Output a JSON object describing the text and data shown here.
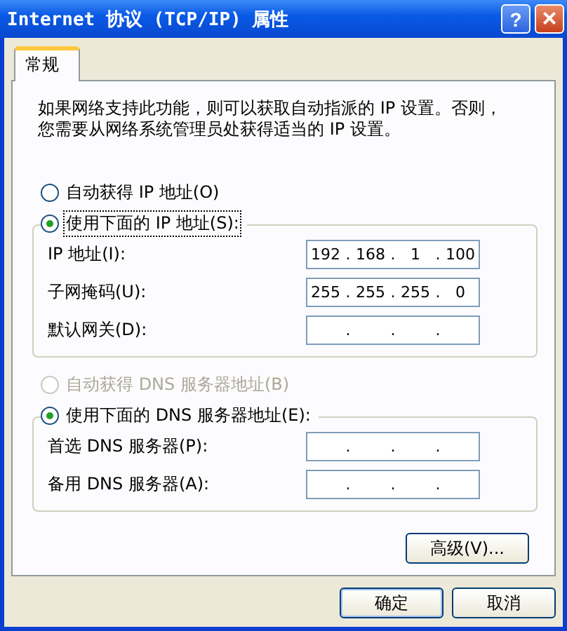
{
  "window": {
    "title": "Internet 协议 (TCP/IP) 属性",
    "help_button": "?",
    "close_button": "×"
  },
  "tabs": [
    {
      "label": "常规",
      "selected": true
    }
  ],
  "intro": "如果网络支持此功能，则可以获取自动指派的 IP 设置。否则，您需要从网络系统管理员处获得适当的 IP 设置。",
  "sections": [
    {
      "auto_option": {
        "label": "自动获得 IP 地址(O)",
        "selected": false,
        "disabled": false
      },
      "manual_option": {
        "label": "使用下面的 IP 地址(S):",
        "selected": true,
        "focused": true
      },
      "fields": [
        {
          "label": "IP 地址(I):",
          "octets": [
            "192",
            "168",
            "1",
            "100"
          ],
          "dots": [
            ".",
            ".",
            "."
          ]
        },
        {
          "label": "子网掩码(U):",
          "octets": [
            "255",
            "255",
            "255",
            "0"
          ],
          "dots": [
            ".",
            ".",
            "."
          ]
        },
        {
          "label": "默认网关(D):",
          "dots": [
            ".",
            ".",
            "."
          ]
        }
      ]
    },
    {
      "auto_option": {
        "label": "自动获得 DNS 服务器地址(B)",
        "selected": false,
        "disabled": true
      },
      "manual_option": {
        "label": "使用下面的 DNS 服务器地址(E):",
        "selected": true,
        "focused": false
      },
      "fields": [
        {
          "label": "首选 DNS 服务器(P):",
          "dots": [
            ".",
            ".",
            "."
          ]
        },
        {
          "label": "备用 DNS 服务器(A):",
          "dots": [
            ".",
            ".",
            "."
          ]
        }
      ]
    }
  ],
  "advanced_button": "高级(V)...",
  "buttons": [
    "确定",
    "取消"
  ]
}
